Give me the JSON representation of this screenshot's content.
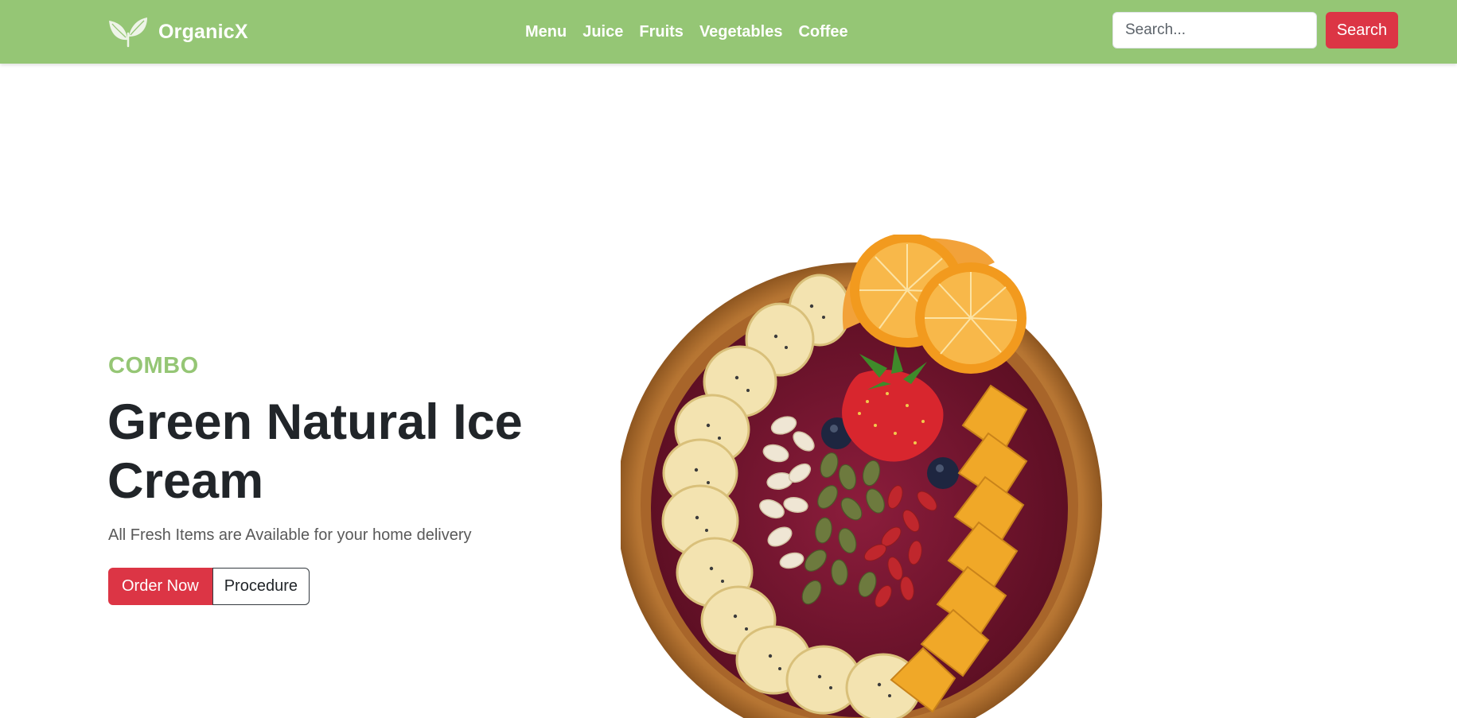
{
  "brand": {
    "name": "OrganicX",
    "logo_icon": "leaf-icon"
  },
  "nav": {
    "links": [
      "Menu",
      "Juice",
      "Fruits",
      "Vegetables",
      "Coffee"
    ]
  },
  "search": {
    "placeholder": "Search...",
    "value": "",
    "button_label": "Search"
  },
  "hero": {
    "eyebrow": "COMBO",
    "title": "Green Natural Ice Cream",
    "subtitle": "All Fresh Items are Available for your home delivery",
    "primary_button": "Order Now",
    "secondary_button": "Procedure",
    "image_alt": "acai-fruit-bowl"
  },
  "colors": {
    "navbar": "#95c675",
    "accent": "#95c675",
    "primary_button": "#dc3545",
    "text_dark": "#212529"
  }
}
